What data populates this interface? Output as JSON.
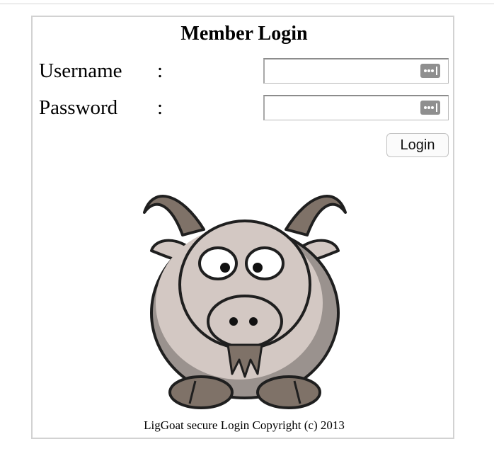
{
  "login_form": {
    "title": "Member Login",
    "username_label": "Username",
    "password_label": "Password",
    "separator": ":",
    "username_value": "",
    "password_value": "",
    "login_button_label": "Login"
  },
  "footer": {
    "copyright": "LigGoat secure Login Copyright (c) 2013"
  },
  "icons": {
    "password_manager": "password-manager-icon",
    "mascot": "goat-mascot"
  },
  "colors": {
    "panel_border": "#d2d2d2",
    "goat_body": "#d3c8c3",
    "goat_horns": "#7f7268",
    "goat_shadow": "#9a928e"
  }
}
